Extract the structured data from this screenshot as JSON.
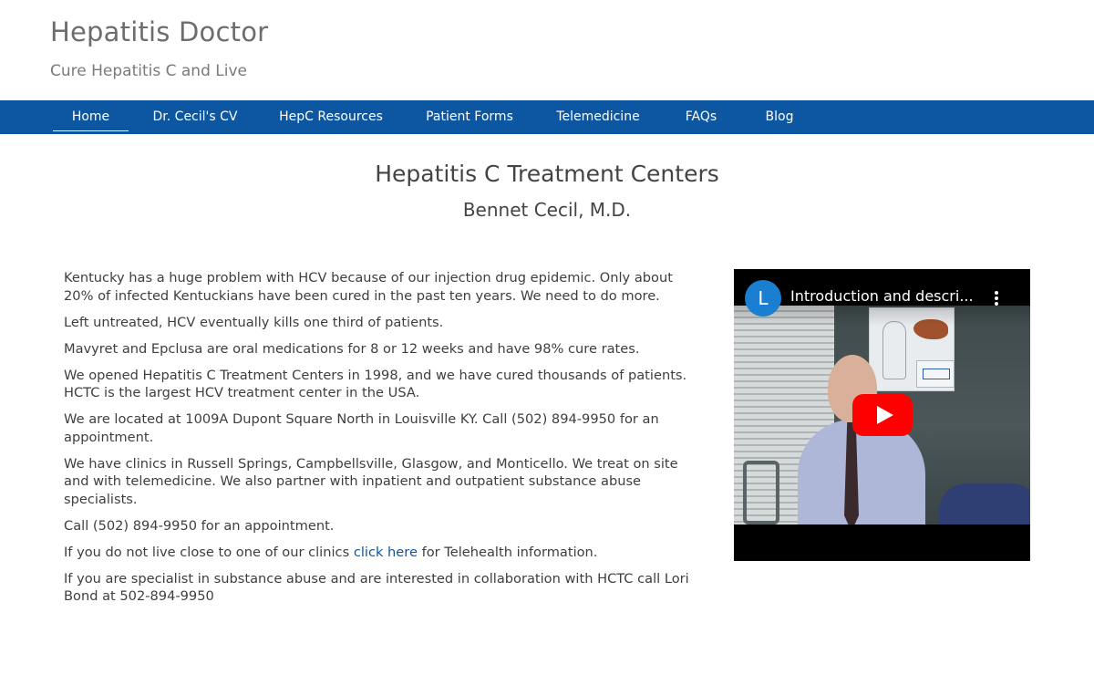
{
  "site": {
    "title": "Hepatitis Doctor",
    "tagline": "Cure Hepatitis C and Live"
  },
  "nav": {
    "items": [
      {
        "label": "Home",
        "active": true
      },
      {
        "label": "Dr. Cecil's CV"
      },
      {
        "label": "HepC Resources"
      },
      {
        "label": "Patient Forms"
      },
      {
        "label": "Telemedicine"
      },
      {
        "label": "FAQs"
      },
      {
        "label": "Blog"
      }
    ]
  },
  "main": {
    "heading": "Hepatitis C Treatment Centers",
    "subheading": "Bennet Cecil, M.D.",
    "paragraphs": [
      "Kentucky has a huge problem with HCV because of our injection drug epidemic. Only about 20% of infected Kentuckians have been cured in the past ten years. We need to do more.",
      "Left untreated, HCV eventually kills one third of patients.",
      "Mavyret and Epclusa are oral medications for 8 or 12 weeks and have 98% cure rates.",
      "We opened Hepatitis C Treatment Centers in 1998, and we have cured thousands of patients. HCTC is the largest HCV treatment center in the USA.",
      "We are located at 1009A Dupont Square North in Louisville KY. Call (502) 894-9950 for an appointment.",
      "We have clinics in Russell Springs, Campbellsville, Glasgow, and Monticello. We treat on site and with telemedicine. We also partner with inpatient and outpatient substance abuse specialists.",
      "Call (502) 894-9950 for an appointment."
    ],
    "telehealth": {
      "before": "If you do not live close to one of our clinics ",
      "link": "click here",
      "after": " for Telehealth information."
    },
    "collab": "If you are specialist in substance abuse and are interested in collaboration with HCTC call Lori Bond at 502-894-9950"
  },
  "video": {
    "channel_initial": "L",
    "title": "Introduction and descri...",
    "icons": {
      "more": "more-vert-icon",
      "play": "play-icon"
    },
    "colors": {
      "play": "#ff0000",
      "avatar": "#1a7fd0"
    }
  },
  "colors": {
    "nav_bg": "#0c56a2",
    "link": "#0c56a2"
  }
}
